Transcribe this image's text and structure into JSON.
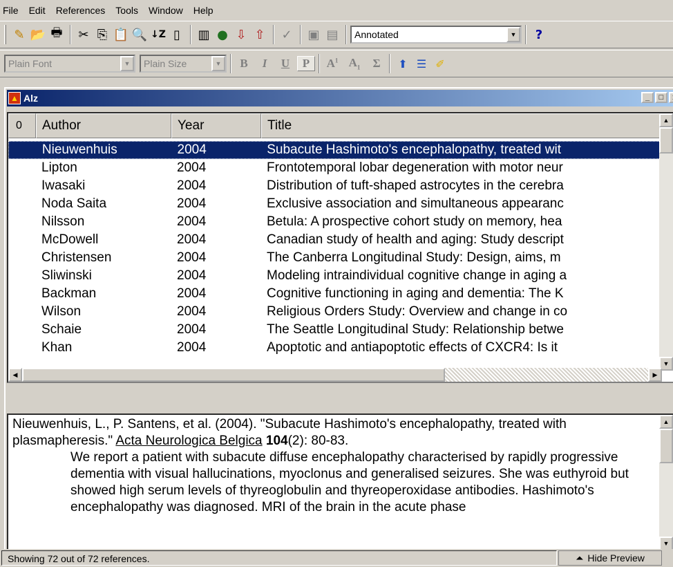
{
  "menu": [
    "File",
    "Edit",
    "References",
    "Tools",
    "Window",
    "Help"
  ],
  "toolbar": {
    "style_select": "Annotated",
    "help_label": "?"
  },
  "formatbar": {
    "font_select": "Plain Font",
    "size_select": "Plain Size",
    "bold": "B",
    "italic": "I",
    "underline": "U",
    "plain": "P",
    "superscript": "A",
    "subscript": "A",
    "symbol": "Σ"
  },
  "library_window": {
    "title": "Alz"
  },
  "columns": {
    "attach": "0",
    "author": "Author",
    "year": "Year",
    "title": "Title"
  },
  "references": [
    {
      "author": "Nieuwenhuis",
      "year": "2004",
      "title": "Subacute Hashimoto's encephalopathy, treated wit"
    },
    {
      "author": "Lipton",
      "year": "2004",
      "title": "Frontotemporal lobar degeneration with motor neur"
    },
    {
      "author": "Iwasaki",
      "year": "2004",
      "title": "Distribution of tuft-shaped astrocytes in the cerebra"
    },
    {
      "author": "Noda Saita",
      "year": "2004",
      "title": "Exclusive association and simultaneous appearanc"
    },
    {
      "author": "Nilsson",
      "year": "2004",
      "title": "Betula: A prospective cohort study on memory, hea"
    },
    {
      "author": "McDowell",
      "year": "2004",
      "title": "Canadian study of health and aging: Study descript"
    },
    {
      "author": "Christensen",
      "year": "2004",
      "title": "The Canberra Longitudinal Study: Design, aims, m"
    },
    {
      "author": "Sliwinski",
      "year": "2004",
      "title": "Modeling intraindividual cognitive change in aging a"
    },
    {
      "author": "Backman",
      "year": "2004",
      "title": "Cognitive functioning in aging and dementia: The K"
    },
    {
      "author": "Wilson",
      "year": "2004",
      "title": "Religious Orders Study: Overview and change in co"
    },
    {
      "author": "Schaie",
      "year": "2004",
      "title": "The Seattle Longitudinal Study: Relationship betwe"
    },
    {
      "author": "Khan",
      "year": "2004",
      "title": "Apoptotic and antiapoptotic effects of CXCR4: Is it"
    }
  ],
  "preview": {
    "citation_pre": "Nieuwenhuis, L., P. Santens, et al. (2004). \"Subacute Hashimoto's encephalopathy, treated with plasmapheresis.\" ",
    "journal": "Acta Neurologica Belgica",
    "volume": "104",
    "issue_pages": "(2): 80-83.",
    "abstract": "We report a patient with subacute diffuse encephalopathy characterised by rapidly progressive dementia with visual hallucinations, myoclonus and generalised seizures. She was euthyroid but showed high serum levels of thyreoglobulin and thyreoperoxidase antibodies. Hashimoto's encephalopathy was diagnosed. MRI of the brain in the acute phase"
  },
  "status": {
    "text": "Showing 72 out of 72 references.",
    "hide_preview": "Hide Preview"
  }
}
